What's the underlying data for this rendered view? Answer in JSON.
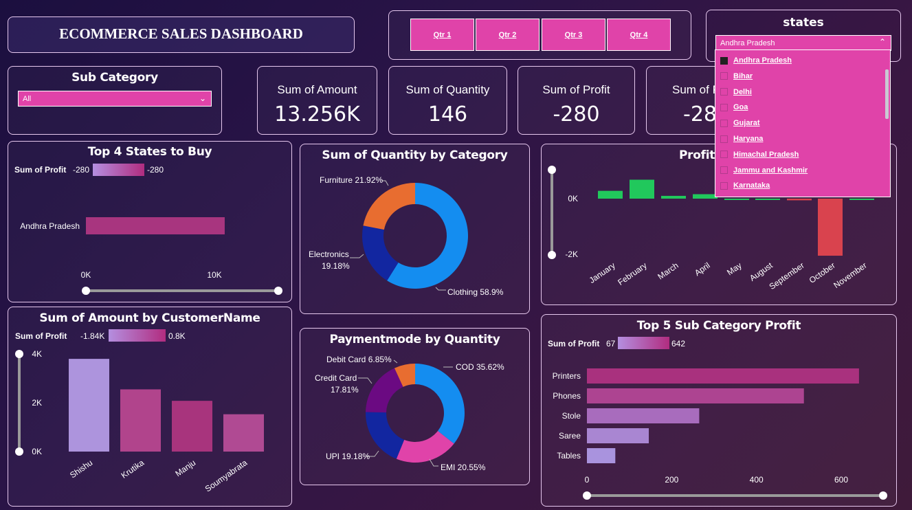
{
  "header": {
    "title": "ECOMMERCE SALES DASHBOARD"
  },
  "quarters": [
    "Qtr 1",
    "Qtr 2",
    "Qtr 3",
    "Qtr 4"
  ],
  "states_slicer": {
    "title": "states",
    "selected": "Andhra Pradesh",
    "options": [
      "Andhra Pradesh",
      "Bihar",
      "Delhi",
      "Goa",
      "Gujarat",
      "Haryana",
      "Himachal Pradesh",
      "Jammu and Kashmir",
      "Karnataka"
    ]
  },
  "subcategory_slicer": {
    "title": "Sub Category",
    "selected": "All"
  },
  "kpis": [
    {
      "label": "Sum of Amount",
      "value": "13.256K"
    },
    {
      "label": "Sum of Quantity",
      "value": "146"
    },
    {
      "label": "Sum of Profit",
      "value": "-280"
    },
    {
      "label": "Sum of P",
      "value": "-28"
    }
  ],
  "top_states": {
    "title": "Top 4 States to Buy",
    "legend_label": "Sum of Profit",
    "legend_min": "-280",
    "legend_max": "-280",
    "color_from": "#b48fe0",
    "color_to": "#b12c7f"
  },
  "customer": {
    "title": "Sum of Amount by CustomerName",
    "legend_label": "Sum of Profit",
    "legend_min": "-1.84K",
    "legend_max": "0.8K"
  },
  "category_donut": {
    "title": "Sum of Quantity by Category",
    "labels": [
      "Furniture 21.92%",
      "Electronics",
      "19.18%",
      "Clothing 58.9%"
    ]
  },
  "payment_donut": {
    "title": "Paymentmode by Quantity",
    "labels": [
      "Debit Card 6.85%",
      "Credit Card",
      "17.81%",
      "COD 35.62%",
      "UPI 19.18%",
      "EMI 20.55%"
    ]
  },
  "profit_month": {
    "title": "Profit b"
  },
  "subcat": {
    "title": "Top 5 Sub Category Profit",
    "legend_label": "Sum of Profit",
    "legend_min": "67",
    "legend_max": "642"
  },
  "chart_data": [
    {
      "type": "bar",
      "title": "Top 4 States to Buy",
      "orientation": "horizontal",
      "categories": [
        "Andhra Pradesh"
      ],
      "values": [
        10800
      ],
      "xlim": [
        0,
        13000
      ],
      "xticks": [
        "0K",
        "10K"
      ]
    },
    {
      "type": "bar",
      "title": "Sum of Amount by CustomerName",
      "categories": [
        "Shishu",
        "Krutika",
        "Manju",
        "Soumyabrata"
      ],
      "values": [
        3800,
        2550,
        2080,
        1530
      ],
      "ylim": [
        0,
        4000
      ],
      "yticks": [
        "0K",
        "2K",
        "4K"
      ],
      "colors": [
        "#ad94dd",
        "#b1448c",
        "#a8347d",
        "#b04a93"
      ]
    },
    {
      "type": "pie",
      "title": "Sum of Quantity by Category",
      "categories": [
        "Clothing",
        "Electronics",
        "Furniture"
      ],
      "values": [
        58.9,
        19.18,
        21.92
      ],
      "colors": [
        "#148df0",
        "#1226a0",
        "#e86d30"
      ]
    },
    {
      "type": "pie",
      "title": "Paymentmode by Quantity",
      "categories": [
        "COD",
        "EMI",
        "UPI",
        "Credit Card",
        "Debit Card"
      ],
      "values": [
        35.62,
        20.55,
        19.18,
        17.81,
        6.85
      ],
      "colors": [
        "#148df0",
        "#e043a9",
        "#1226a0",
        "#6b0a82",
        "#e86d30"
      ]
    },
    {
      "type": "bar",
      "title": "Profit b",
      "categories": [
        "January",
        "February",
        "March",
        "April",
        "May",
        "August",
        "September",
        "October",
        "November"
      ],
      "values": [
        280,
        680,
        100,
        160,
        0,
        0,
        -60,
        -2050,
        0
      ],
      "ylim": [
        -2300,
        1000
      ],
      "yticks": [
        "0K",
        "-2K"
      ],
      "positive_color": "#21c85c",
      "negative_color": "#d9434e"
    },
    {
      "type": "bar",
      "title": "Top 5 Sub Category Profit",
      "orientation": "horizontal",
      "categories": [
        "Printers",
        "Phones",
        "Stole",
        "Saree",
        "Tables"
      ],
      "values": [
        642,
        512,
        265,
        146,
        67
      ],
      "xlim": [
        0,
        700
      ],
      "xticks": [
        "0",
        "200",
        "400",
        "600"
      ],
      "colors": [
        "#a9317e",
        "#ad4491",
        "#a86cbd",
        "#a986d2",
        "#a993de"
      ]
    }
  ]
}
